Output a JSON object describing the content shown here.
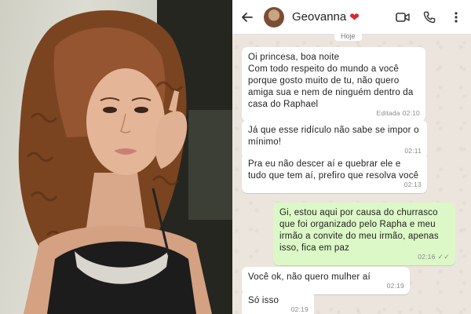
{
  "chat": {
    "contact_name": "Geovanna",
    "date_label": "Hoje",
    "messages": [
      {
        "direction": "in",
        "text": "Oi princesa, boa noite\nCom todo respeito do mundo a você porque gosto muito de tu, não quero amiga sua e nem de ninguém dentro da casa do Raphael",
        "edited_label": "Editada",
        "time": "02:10"
      },
      {
        "direction": "in",
        "text": "Já que esse ridículo não sabe se impor o mínimo!",
        "time": "02:11"
      },
      {
        "direction": "in",
        "text": "Pra eu não descer aí e quebrar ele e tudo que tem aí, prefiro que resolva você",
        "time": "02:13"
      },
      {
        "direction": "out",
        "text": "Gi, estou aqui por causa do churrasco que foi organizado pelo Rapha e meu irmão a convite do meu irmão, apenas isso, fica em paz",
        "time": "02:16",
        "ticks": "✓✓"
      },
      {
        "direction": "in",
        "text": "Você ok, não quero mulher aí",
        "time": "02:19"
      },
      {
        "direction": "in",
        "text": "Só isso",
        "time": "02:19"
      }
    ]
  },
  "icons": {
    "back": "arrow-left-icon",
    "video": "video-call-icon",
    "phone": "phone-call-icon",
    "menu": "more-vert-icon",
    "heart": "❤"
  },
  "colors": {
    "incoming_bubble": "#ffffff",
    "outgoing_bubble": "#dcf8c6",
    "chat_background": "#ece5dd",
    "heart": "#e0252d"
  }
}
